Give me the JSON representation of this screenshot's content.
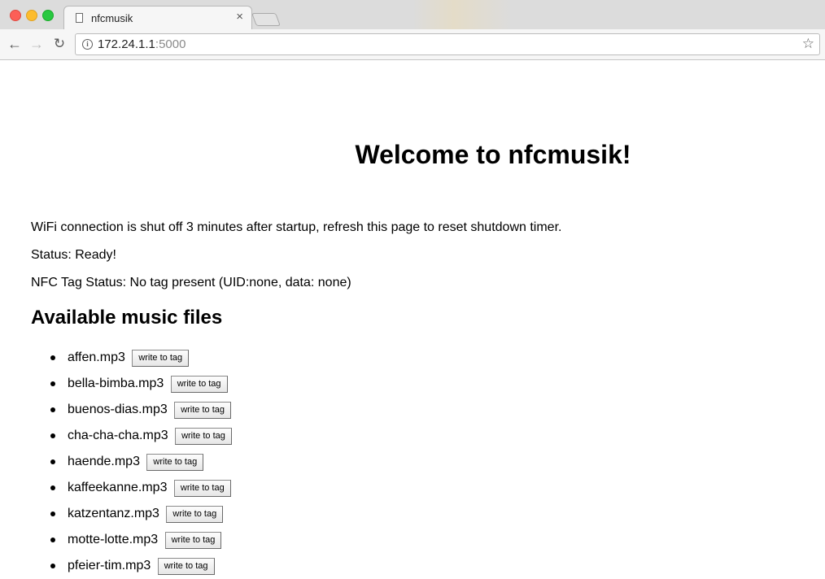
{
  "browser": {
    "tab_title": "nfcmusik",
    "tab_close": "×",
    "url_host": "172.24.1.1",
    "url_port": ":5000",
    "icons": {
      "back": "arrow-left-icon",
      "forward": "arrow-right-icon",
      "reload": "reload-icon",
      "info": "info-icon",
      "bookmark": "star-icon",
      "page": "page-icon"
    },
    "colors": {
      "close": "#fc5f57",
      "minimize": "#fdbc2e",
      "maximize": "#28c840"
    }
  },
  "page": {
    "title": "Welcome to nfcmusik!",
    "wifi_note": "WiFi connection is shut off 3 minutes after startup, refresh this page to reset shutdown timer.",
    "status": "Status: Ready!",
    "nfc_status": "NFC Tag Status: No tag present (UID:none, data: none)",
    "files_heading": "Available music files",
    "write_label": "write to tag",
    "files": [
      "affen.mp3",
      "bella-bimba.mp3",
      "buenos-dias.mp3",
      "cha-cha-cha.mp3",
      "haende.mp3",
      "kaffeekanne.mp3",
      "katzentanz.mp3",
      "motte-lotte.mp3",
      "pfeier-tim.mp3"
    ]
  }
}
